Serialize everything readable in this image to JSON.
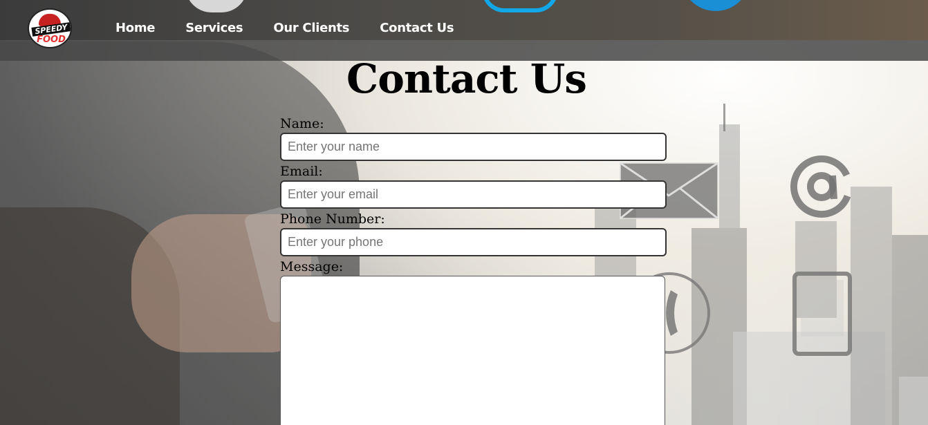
{
  "header": {
    "logo": {
      "line1": "SPEEDY",
      "line2": "FOOD"
    },
    "nav": [
      {
        "label": "Home"
      },
      {
        "label": "Services"
      },
      {
        "label": "Our Clients"
      },
      {
        "label": "Contact Us"
      }
    ]
  },
  "main": {
    "title": "Contact Us",
    "form": {
      "name": {
        "label": "Name:",
        "value": "",
        "placeholder": "Enter your name"
      },
      "email": {
        "label": "Email:",
        "value": "",
        "placeholder": "Enter your email"
      },
      "phone": {
        "label": "Phone Number:",
        "value": "",
        "placeholder": "Enter your phone"
      },
      "message": {
        "label": "Message:",
        "value": ""
      }
    }
  },
  "background_icons": [
    "envelope-icon",
    "at-sign-icon",
    "telephone-icon",
    "tablet-icon"
  ],
  "colors": {
    "header_bg": "#4a4a4a",
    "nav_text": "#ffffff",
    "logo_red": "#c72222",
    "title_text": "#000000",
    "input_border": "#333333"
  }
}
